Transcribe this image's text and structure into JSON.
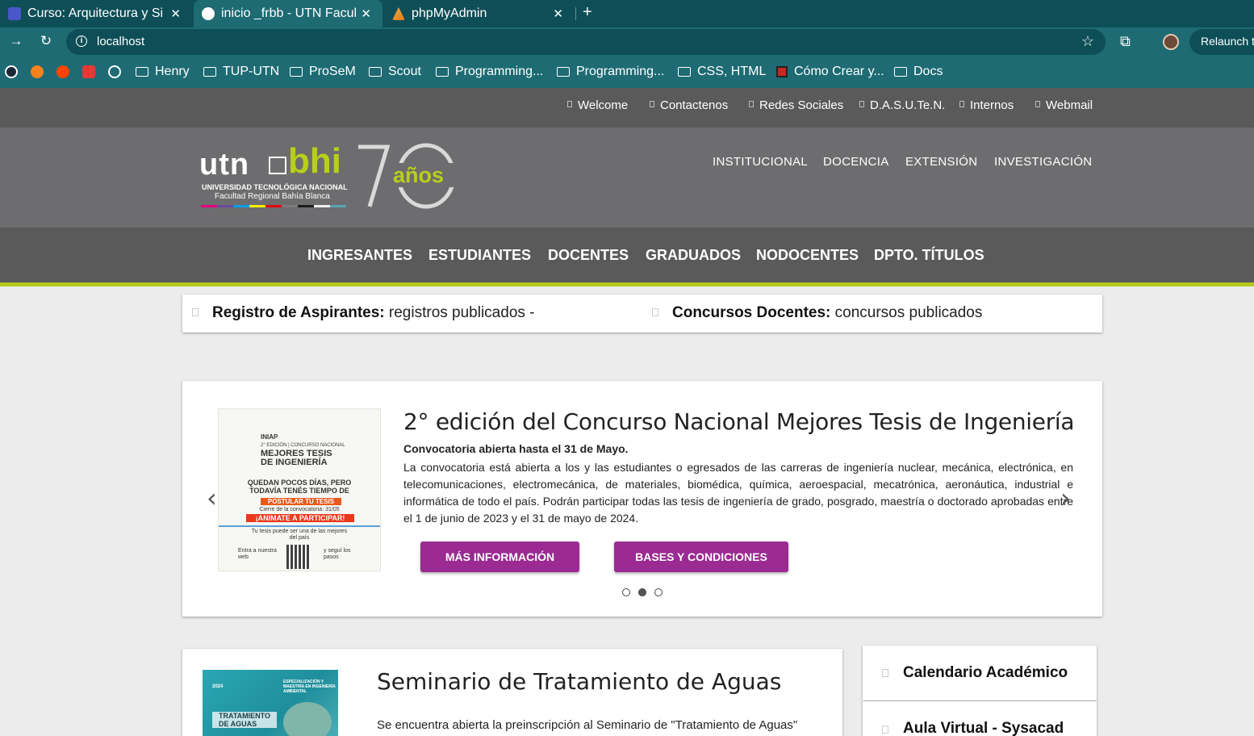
{
  "browser": {
    "tabs": [
      {
        "title": "Curso: Arquitectura y Si",
        "active": false
      },
      {
        "title": "inicio _frbb - UTN Facult",
        "active": true
      },
      {
        "title": "phpMyAdmin",
        "active": false
      }
    ],
    "url": "localhost",
    "relaunch_label": "Relaunch t",
    "bookmarks": [
      "Henry",
      "TUP-UTN",
      "ProSeM",
      "Scout",
      "Programming...",
      "Programming...",
      "CSS, HTML",
      "Cómo Crear y...",
      "Docs"
    ]
  },
  "site": {
    "top_links": [
      "Welcome",
      "Contactenos",
      "Redes Sociales",
      "D.A.S.U.Te.N.",
      "Internos",
      "Webmail"
    ],
    "logo": {
      "utn": "utn",
      "bhi": "bhi",
      "line1": "UNIVERSIDAD TECNOLÓGICA NACIONAL",
      "line2": "Facultad Regional Bahía Blanca",
      "anos": "años"
    },
    "main_links": [
      "INSTITUCIONAL",
      "DOCENCIA",
      "EXTENSIÓN",
      "INVESTIGACIÓN"
    ],
    "menu": [
      "INGRESANTES",
      "ESTUDIANTES",
      "DOCENTES",
      "GRADUADOS",
      "NODOCENTES",
      "DPTO. TÍTULOS"
    ],
    "notices": [
      {
        "bold": "Registro de Aspirantes:",
        "text": " registros publicados -"
      },
      {
        "bold": "Concursos Docentes:",
        "text": " concursos publicados"
      }
    ],
    "slide": {
      "title": "2° edición del Concurso Nacional Mejores Tesis de Ingeniería",
      "subtitle": "Convocatoria abierta hasta el 31 de Mayo.",
      "body": "La convocatoria está abierta a los y las estudiantes o egresados de las carreras de ingeniería nuclear, mecánica, electrónica, en telecomunicaciones, electromecánica, de materiales, biomédica, química, aeroespacial, mecatrónica, aeronáutica, industrial e informática de todo el país. Podrán participar todas las tesis de ingeniería de grado, posgrado, maestría o doctorado aprobadas entre el 1 de junio de 2023 y el 31 de mayo de 2024.",
      "btn_more": "MÁS INFORMACIÓN",
      "btn_rules": "BASES Y CONDICIONES",
      "active_dot": 1,
      "poster": {
        "inaip": "INIAP",
        "line1": "2° EDICIÓN | CONCURSO NACIONAL",
        "title": "MEJORES TESIS DE INGENIERÍA",
        "question": "QUEDAN POCOS DÍAS, PERO TODAVÍA TENÉS TIEMPO DE",
        "postular": "POSTULAR TU TESIS",
        "cierre": "Cierre de la convocatoria: 31/05",
        "animate": "¡ANIMATE A PARTICIPAR!",
        "tesis": "Tu tesis puede ser una de las mejores del país",
        "entra": "Entra a nuestra web",
        "segui": "y seguí los pasos"
      }
    },
    "news": {
      "title": "Seminario de Tratamiento de Aguas",
      "body": "Se encuentra abierta la preinscripción al Seminario de \"Tratamiento de Aguas\"",
      "img_year": "2024",
      "img_head": "ESPECIALIZACIÓN Y MAESTRÍA EN INGENIERÍA AMBIENTAL",
      "img_title": "TRATAMIENTO DE AGUAS"
    },
    "sidebar": [
      "Calendario Académico",
      "Aula Virtual - Sysacad"
    ]
  },
  "colors": {
    "accent_green": "#b4c91e",
    "button_purple": "#9b2a93",
    "header_gray": "#6d6d6f",
    "chrome_teal": "#1e6b73"
  }
}
